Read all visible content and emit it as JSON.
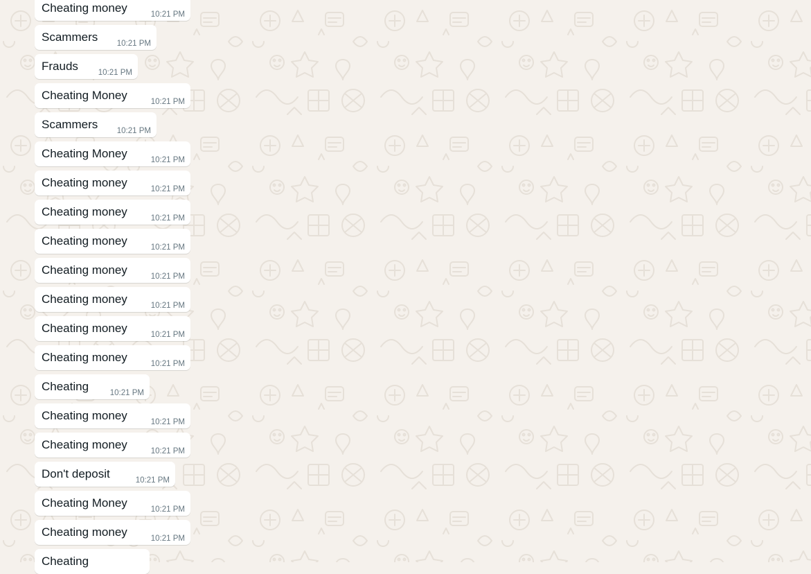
{
  "theme": {
    "background": "#f5f1ec",
    "doodle_stroke": "#e6e0d8",
    "bubble_background": "#ffffff",
    "text_color": "#111b21",
    "time_color": "#667781"
  },
  "messages": [
    {
      "text": "Cheating money",
      "time": "10:21 PM"
    },
    {
      "text": "Scammers",
      "time": "10:21 PM"
    },
    {
      "text": "Frauds",
      "time": "10:21 PM"
    },
    {
      "text": "Cheating Money",
      "time": "10:21 PM"
    },
    {
      "text": "Scammers",
      "time": "10:21 PM"
    },
    {
      "text": "Cheating Money",
      "time": "10:21 PM"
    },
    {
      "text": "Cheating money",
      "time": "10:21 PM"
    },
    {
      "text": "Cheating money",
      "time": "10:21 PM"
    },
    {
      "text": "Cheating money",
      "time": "10:21 PM"
    },
    {
      "text": "Cheating money",
      "time": "10:21 PM"
    },
    {
      "text": "Cheating money",
      "time": "10:21 PM"
    },
    {
      "text": "Cheating money",
      "time": "10:21 PM"
    },
    {
      "text": "Cheating money",
      "time": "10:21 PM"
    },
    {
      "text": "Cheating",
      "time": "10:21 PM"
    },
    {
      "text": "Cheating money",
      "time": "10:21 PM"
    },
    {
      "text": "Cheating money",
      "time": "10:21 PM"
    },
    {
      "text": "Don't deposit",
      "time": "10:21 PM"
    },
    {
      "text": "Cheating Money",
      "time": "10:21 PM"
    },
    {
      "text": "Cheating money",
      "time": "10:21 PM"
    },
    {
      "text": "Cheating",
      "time": ""
    }
  ]
}
